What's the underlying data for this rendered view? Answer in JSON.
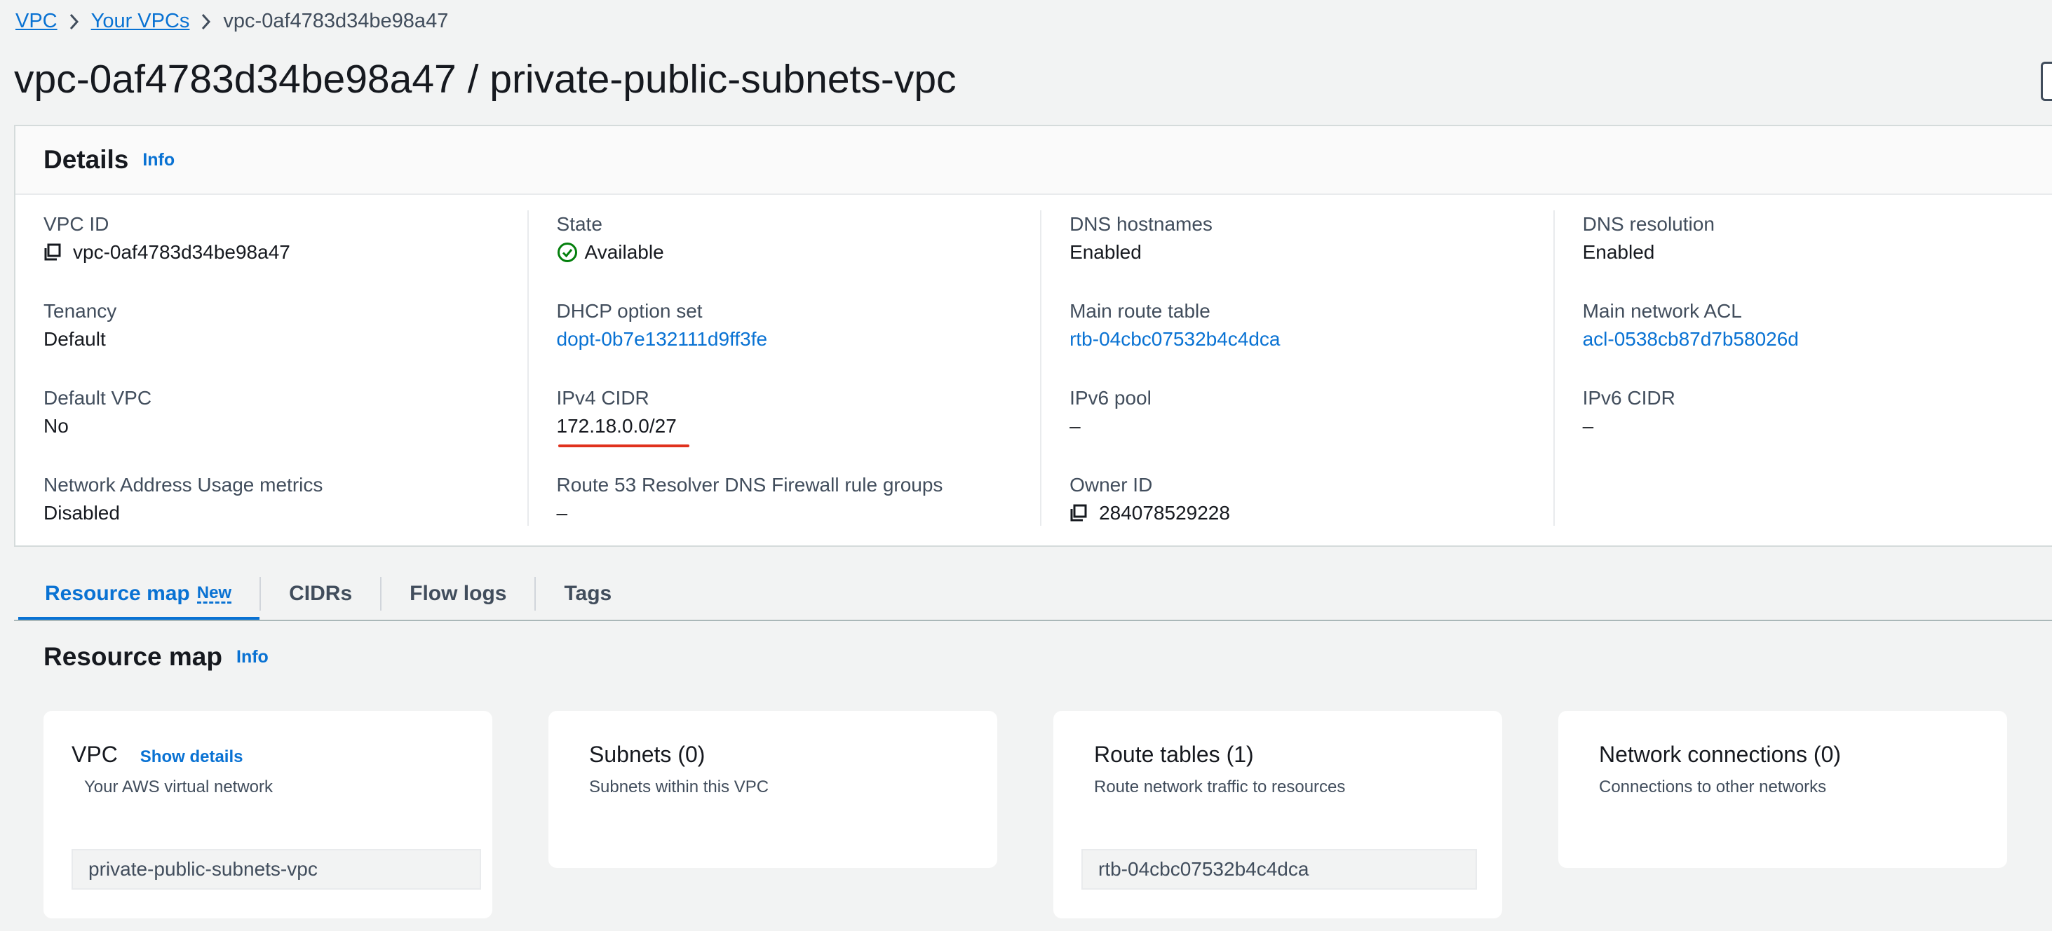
{
  "breadcrumb": {
    "items": [
      "VPC",
      "Your VPCs"
    ],
    "current": "vpc-0af4783d34be98a47"
  },
  "page_title": "vpc-0af4783d34be98a47 / private-public-subnets-vpc",
  "details": {
    "title": "Details",
    "info": "Info",
    "columns": [
      [
        {
          "label": "VPC ID",
          "value": "vpc-0af4783d34be98a47",
          "icon": "copy-icon"
        },
        {
          "label": "Tenancy",
          "value": "Default"
        },
        {
          "label": "Default VPC",
          "value": "No"
        },
        {
          "label": "Network Address Usage metrics",
          "value": "Disabled"
        }
      ],
      [
        {
          "label": "State",
          "value": "Available",
          "icon": "check-circle-icon",
          "color": "#037f0c"
        },
        {
          "label": "DHCP option set",
          "value": "dopt-0b7e132111d9ff3fe",
          "link": true
        },
        {
          "label": "IPv4 CIDR",
          "value": "172.18.0.0/27",
          "annotation_color": "#e0311d"
        },
        {
          "label": "Route 53 Resolver DNS Firewall rule groups",
          "value": "–"
        }
      ],
      [
        {
          "label": "DNS hostnames",
          "value": "Enabled"
        },
        {
          "label": "Main route table",
          "value": "rtb-04cbc07532b4c4dca",
          "link": true
        },
        {
          "label": "IPv6 pool",
          "value": "–"
        },
        {
          "label": "Owner ID",
          "value": "284078529228",
          "icon": "copy-icon"
        }
      ],
      [
        {
          "label": "DNS resolution",
          "value": "Enabled"
        },
        {
          "label": "Main network ACL",
          "value": "acl-0538cb87d7b58026d",
          "link": true
        },
        {
          "label": "IPv6 CIDR",
          "value": "–"
        }
      ]
    ]
  },
  "tabs": {
    "items": [
      "Resource map",
      "CIDRs",
      "Flow logs",
      "Tags"
    ],
    "active": "Resource map",
    "new_badge": "New"
  },
  "resource_map": {
    "title": "Resource map",
    "info": "Info",
    "cards": [
      {
        "title": "VPC",
        "action": "Show details",
        "subtitle": "Your AWS virtual network",
        "chip": "private-public-subnets-vpc"
      },
      {
        "title": "Subnets (0)",
        "subtitle": "Subnets within this VPC"
      },
      {
        "title": "Route tables (1)",
        "subtitle": "Route network traffic to resources",
        "chip": "rtb-04cbc07532b4c4dca"
      },
      {
        "title": "Network connections (0)",
        "subtitle": "Connections to other networks"
      }
    ]
  },
  "colors": {
    "link": "#0972d3",
    "success": "#037f0c",
    "annotation": "#e0311d"
  }
}
